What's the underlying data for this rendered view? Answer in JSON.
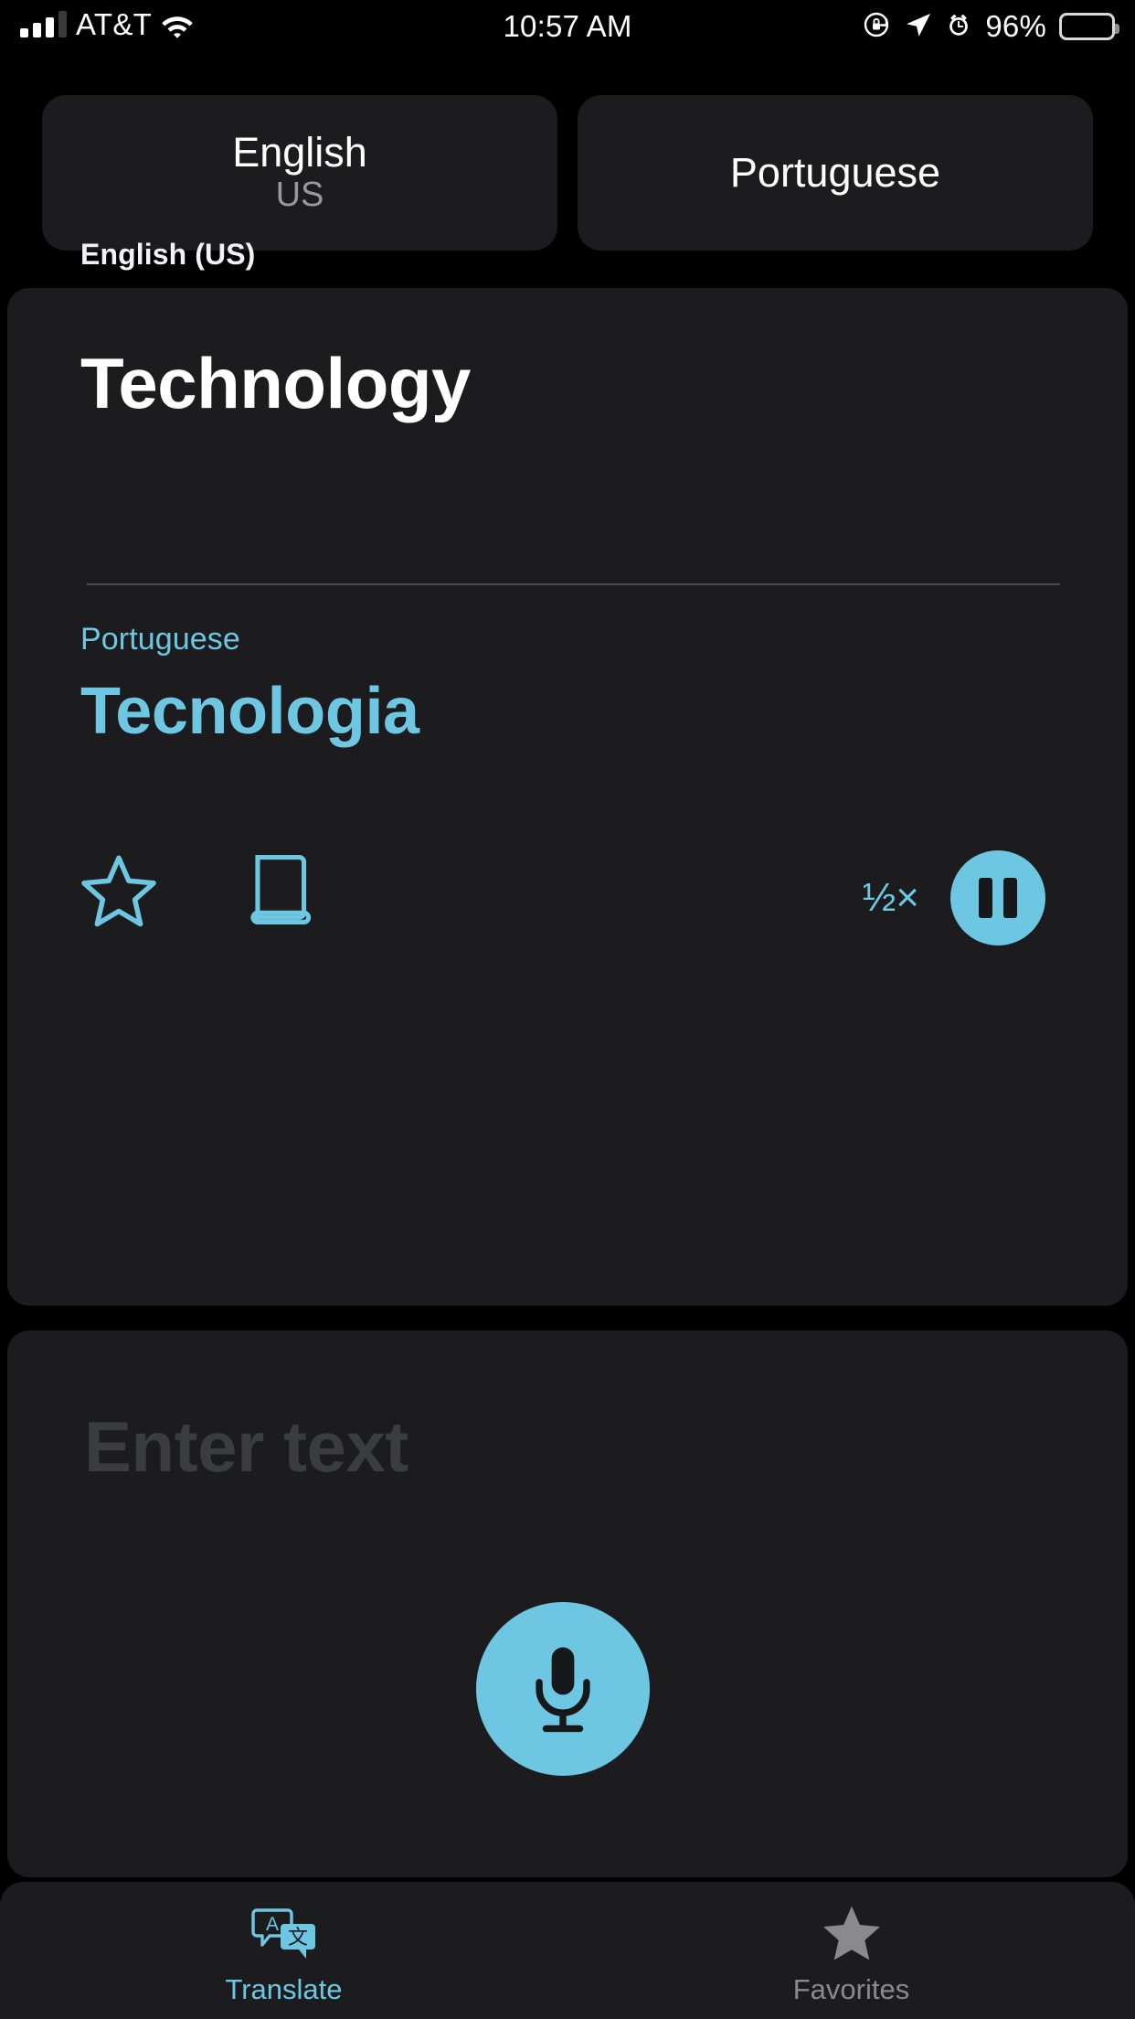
{
  "status_bar": {
    "carrier": "AT&T",
    "time": "10:57 AM",
    "battery_percent": "96%",
    "icons": [
      "signal-bars-icon",
      "wifi-icon",
      "rotation-lock-icon",
      "location-arrow-icon",
      "alarm-clock-icon",
      "battery-icon"
    ]
  },
  "language_selector": {
    "source": {
      "name": "English",
      "region": "US"
    },
    "target": {
      "name": "Portuguese",
      "region": ""
    }
  },
  "translation": {
    "source_label": "English (US)",
    "source_text": "Technology",
    "target_label": "Portuguese",
    "target_text": "Tecnologia",
    "playback_rate": "½×",
    "favorite_icon": "star-outline-icon",
    "dictionary_icon": "book-icon",
    "play_icon": "pause-icon"
  },
  "input": {
    "placeholder": "Enter text",
    "value": "",
    "mic_icon": "microphone-icon"
  },
  "tabs": [
    {
      "label": "Translate",
      "icon": "translate-icon",
      "active": true
    },
    {
      "label": "Favorites",
      "icon": "star-filled-icon",
      "active": false
    }
  ],
  "colors": {
    "accent": "#6dc7e3",
    "background": "#000000",
    "card": "#1c1c1e",
    "muted_text": "#8a8a8e",
    "placeholder": "#3b3c3f"
  }
}
